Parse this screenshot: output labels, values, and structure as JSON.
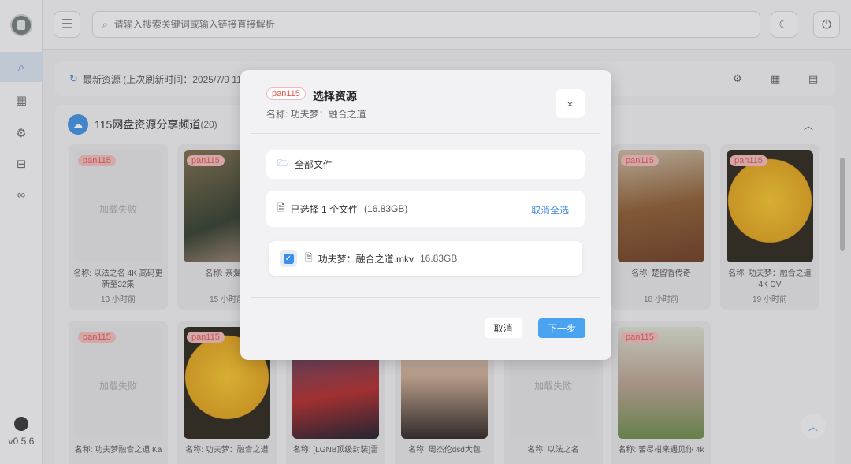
{
  "sidebar": {
    "items": [
      {
        "icon": "search-icon",
        "glyph": "⌕"
      },
      {
        "icon": "film-icon",
        "glyph": "▦"
      },
      {
        "icon": "gear-icon",
        "glyph": "⚙"
      },
      {
        "icon": "inbox-icon",
        "glyph": "⊟"
      },
      {
        "icon": "link-icon",
        "glyph": "∞"
      }
    ],
    "version": "v0.5.6"
  },
  "topbar": {
    "search_placeholder": "请输入搜索关键词或输入链接直接解析"
  },
  "refresh": {
    "label": "最新资源 (上次刷新时间：2025/7/9 11:5"
  },
  "channel": {
    "title": "115网盘资源分享频道",
    "count": "(20)"
  },
  "cards": [
    {
      "tag": "pan115",
      "fail": "加载失败",
      "name": "名称: 以法之名 4K 高码更新至32集",
      "time": "13 小时前"
    },
    {
      "tag": "pan115",
      "fail": "",
      "name": "名称: 亲爱的",
      "time": "15 小时前"
    },
    {
      "tag": "pan115",
      "fail": "",
      "name": "名称: 楚留香传奇",
      "time": "18 小时前"
    },
    {
      "tag": "pan115",
      "fail": "",
      "name": "名称: 功夫梦：融合之道 4K DV",
      "time": "19 小时前"
    },
    {
      "tag": "pan115",
      "fail": "加载失败",
      "name": "名称: 功夫梦融合之道 Ka",
      "time": ""
    },
    {
      "tag": "pan115",
      "fail": "",
      "name": "名称: 功夫梦：融合之道",
      "time": ""
    },
    {
      "tag": "",
      "fail": "",
      "name": "名称: [LGNB顶级封装]雷",
      "time": ""
    },
    {
      "tag": "",
      "fail": "",
      "name": "名称: 周杰伦dsd大包",
      "time": ""
    },
    {
      "tag": "",
      "fail": "加载失败",
      "name": "名称: 以法之名",
      "time": ""
    },
    {
      "tag": "pan115",
      "fail": "",
      "name": "名称: 苦尽柑来遇见你 4k",
      "time": ""
    }
  ],
  "modal": {
    "tag": "pan115",
    "title": "选择资源",
    "subtitle": "名称: 功夫梦：融合之道",
    "close": "×",
    "all_files": "全部文件",
    "selected_text": "已选择 1 个文件",
    "selected_size": "(16.83GB)",
    "deselect_all": "取消全选",
    "file_name": "功夫梦：融合之道.mkv",
    "file_size": "16.83GB",
    "file_checked": true,
    "cancel": "取消",
    "next": "下一步"
  }
}
